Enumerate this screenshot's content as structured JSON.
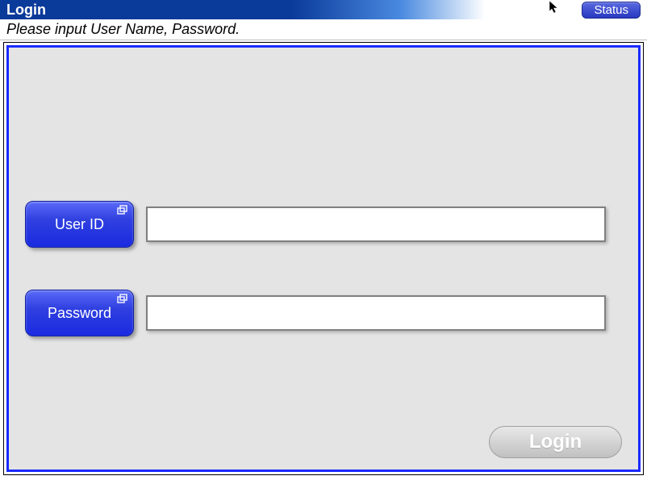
{
  "titlebar": {
    "title": "Login",
    "status_label": "Status"
  },
  "subtitle": "Please input User Name, Password.",
  "fields": {
    "user_id": {
      "button_label": "User ID",
      "value": ""
    },
    "password": {
      "button_label": "Password",
      "value": ""
    }
  },
  "login_button_label": "Login"
}
